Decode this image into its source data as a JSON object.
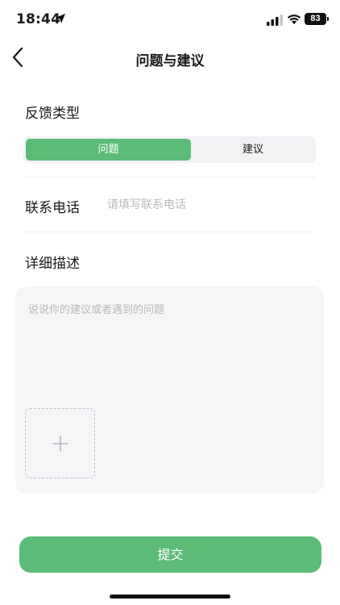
{
  "status_bar": {
    "time": "18:44",
    "battery": "83",
    "icons": [
      "location-arrow-icon",
      "signal-icon",
      "wifi-icon",
      "battery-icon"
    ]
  },
  "nav": {
    "title": "问题与建议",
    "back_icon": "chevron-left-icon"
  },
  "feedback_type": {
    "label": "反馈类型",
    "options": [
      "问题",
      "建议"
    ],
    "selected": "问题"
  },
  "contact": {
    "label": "联系电话",
    "value": "",
    "placeholder": "请填写联系电话"
  },
  "description": {
    "label": "详细描述",
    "value": "",
    "placeholder": "说说你的建议或者遇到的问题",
    "upload_icon": "plus-icon"
  },
  "submit_label": "提交",
  "colors": {
    "accent": "#5cbc77",
    "segment_bg": "#f1f2f4",
    "input_bg": "#f5f6f8",
    "placeholder": "#b9b9b9"
  }
}
